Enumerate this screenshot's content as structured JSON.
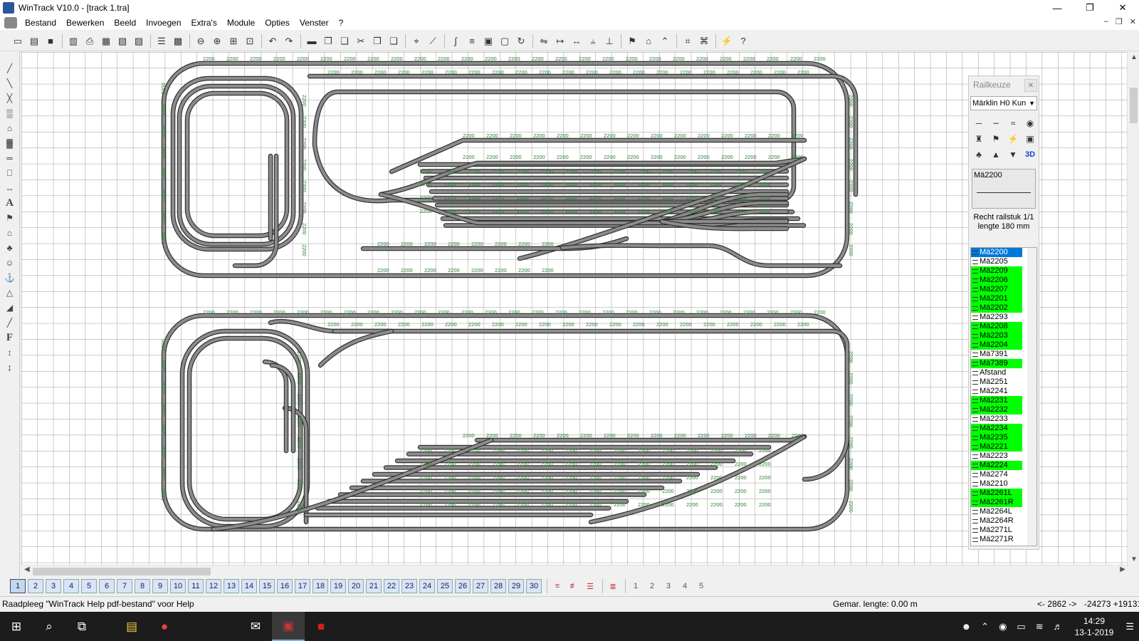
{
  "window": {
    "title": "WinTrack  V10.0 - [track 1.tra]"
  },
  "menu": [
    "Bestand",
    "Bewerken",
    "Beeld",
    "Invoegen",
    "Extra's",
    "Module",
    "Opties",
    "Venster",
    "?"
  ],
  "toolbar_icons": [
    "new-icon",
    "open-icon",
    "save-icon",
    "print-preview-icon",
    "print-icon",
    "print-setup-icon",
    "clipboard-icon",
    "import-icon",
    "properties-icon",
    "image-icon",
    "zoom-out-icon",
    "zoom-in-icon",
    "zoom-window-icon",
    "zoom-fit-icon",
    "undo-icon",
    "redo-icon",
    "delete-icon",
    "copy-icon",
    "paste-icon",
    "cut-icon",
    "duplicate-icon",
    "clone-icon",
    "select-icon",
    "pointer-icon",
    "flex-icon",
    "align-icon",
    "group-icon",
    "ungroup-icon",
    "rotate-icon",
    "mirror-icon",
    "measure-icon",
    "connect-icon",
    "split-icon",
    "join-icon",
    "marker-icon",
    "lock-icon",
    "unlock-icon",
    "grid-icon",
    "snap-icon",
    "power-icon",
    "help-icon"
  ],
  "left_tools": [
    "flex-track-icon",
    "flex-track-2-icon",
    "flex-track-3-icon",
    "wall-icon",
    "roof-icon",
    "ballast-icon",
    "platform-icon",
    "building-icon",
    "dimension-icon",
    "text-icon",
    "signal-icon",
    "house-icon",
    "tree-icon",
    "figure-icon",
    "crane-icon",
    "hill-icon",
    "landscape-icon",
    "road-icon",
    "font-icon",
    "level-icon",
    "level-2-icon"
  ],
  "layers": [
    "1",
    "2",
    "3",
    "4",
    "5",
    "6",
    "7",
    "8",
    "9",
    "10",
    "11",
    "12",
    "13",
    "14",
    "15",
    "16",
    "17",
    "18",
    "19",
    "20",
    "21",
    "22",
    "23",
    "24",
    "25",
    "26",
    "27",
    "28",
    "29",
    "30"
  ],
  "layer_buttons": [
    "layers-icon",
    "layers-hide-icon",
    "layers-edit-icon",
    "layers-all-icon",
    "page-1-icon",
    "page-2-icon",
    "page-3-icon",
    "page-4-icon",
    "page-5-icon"
  ],
  "railpanel": {
    "title": "Railkeuze",
    "system": "Märklin H0 Kun",
    "preview_label": "Mä2200",
    "description_1": "Recht railstuk 1/1",
    "description_2": "lengte 180 mm",
    "parts": [
      {
        "label": "Mä2200",
        "state": "selected"
      },
      {
        "label": "Mä2205",
        "state": "none"
      },
      {
        "label": "Mä2209",
        "state": "green"
      },
      {
        "label": "Mä2206",
        "state": "green"
      },
      {
        "label": "Mä2207",
        "state": "green"
      },
      {
        "label": "Mä2201",
        "state": "green"
      },
      {
        "label": "Mä2202",
        "state": "green"
      },
      {
        "label": "Mä2293",
        "state": "none"
      },
      {
        "label": "Mä2208",
        "state": "green"
      },
      {
        "label": "Mä2203",
        "state": "green"
      },
      {
        "label": "Mä2204",
        "state": "green"
      },
      {
        "label": "Mä7391",
        "state": "none"
      },
      {
        "label": "Mä7389",
        "state": "green"
      },
      {
        "label": "Afstand",
        "state": "none"
      },
      {
        "label": "Mä2251",
        "state": "none"
      },
      {
        "label": "Mä2241",
        "state": "none"
      },
      {
        "label": "Mä2231",
        "state": "green"
      },
      {
        "label": "Mä2232",
        "state": "green"
      },
      {
        "label": "Mä2233",
        "state": "none"
      },
      {
        "label": "Mä2234",
        "state": "green"
      },
      {
        "label": "Mä2235",
        "state": "green"
      },
      {
        "label": "Mä2221",
        "state": "green"
      },
      {
        "label": "Mä2223",
        "state": "none"
      },
      {
        "label": "Mä2224",
        "state": "green"
      },
      {
        "label": "Mä2274",
        "state": "none"
      },
      {
        "label": "Mä2210",
        "state": "none"
      },
      {
        "label": "Mä2261L",
        "state": "green"
      },
      {
        "label": "Mä2261R",
        "state": "green"
      },
      {
        "label": "Mä2264L",
        "state": "none"
      },
      {
        "label": "Mä2264R",
        "state": "none"
      },
      {
        "label": "Mä2271L",
        "state": "none"
      },
      {
        "label": "Mä2271R",
        "state": "none"
      }
    ]
  },
  "status": {
    "hint": "Raadpleeg \"WinTrack Help pdf-bestand\" voor Help",
    "length": "Gemar. lengte:  0.00 m",
    "distance": "<- 2862 ->",
    "coords": "-24273 +19131"
  },
  "taskbar": {
    "time": "14:29",
    "date": "13-1-2019",
    "apps": [
      "windows-start-icon",
      "search-icon",
      "task-view-icon",
      "file-explorer-icon",
      "chrome-icon",
      "mail-icon",
      "wintrack-icon",
      "app-icon"
    ]
  },
  "track_label": "2200",
  "colors": {
    "track": "#8c8c8c",
    "track_edge": "#333333",
    "grid": "#9a9a9a",
    "label": "#2f7d2f",
    "list_green": "#00ff00",
    "list_select": "#0078d7"
  }
}
